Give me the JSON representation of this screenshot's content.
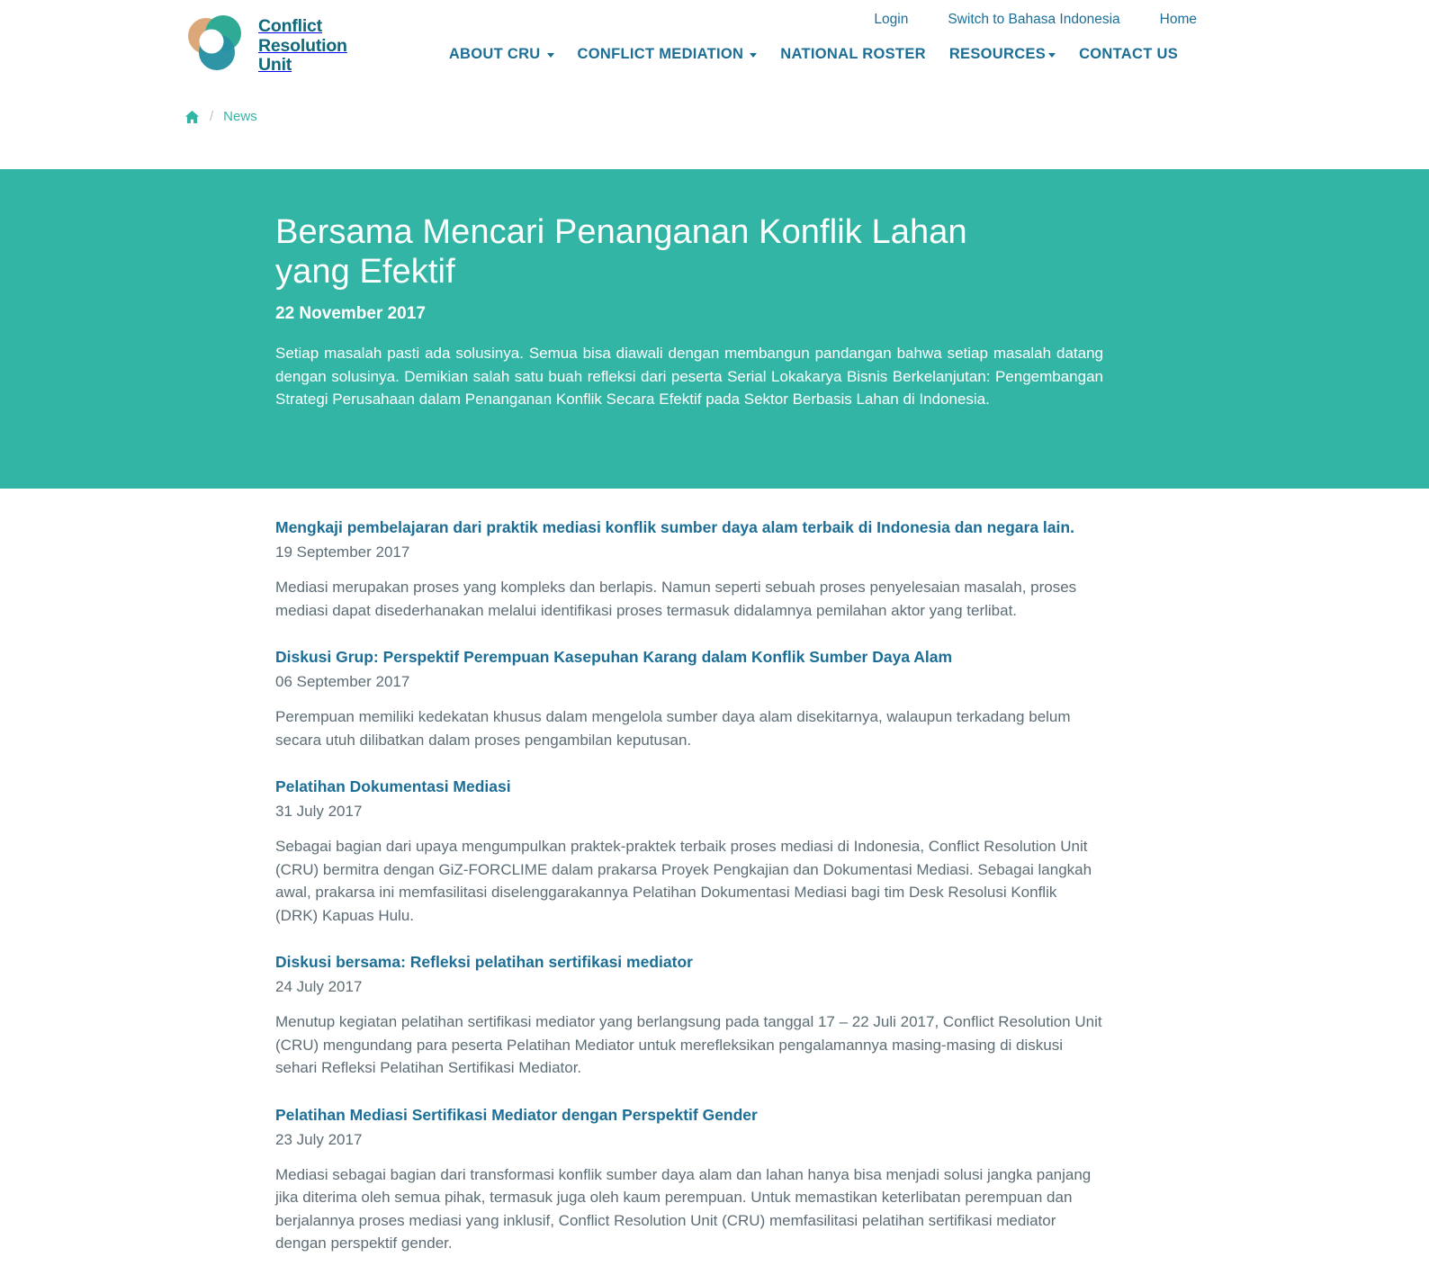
{
  "brand": {
    "logo_icon": "cru-circles-logo",
    "name": "Conflict\nResolution\nUnit"
  },
  "header": {
    "top_links": [
      {
        "label": "Login",
        "name": "login-link"
      },
      {
        "label": "Switch to Bahasa Indonesia",
        "name": "language-switch-link"
      },
      {
        "label": "Home",
        "name": "home-link"
      }
    ],
    "nav": [
      {
        "label": "ABOUT CRU",
        "has_caret": true
      },
      {
        "label": "CONFLICT MEDIATION",
        "has_caret": true
      },
      {
        "label": "NATIONAL ROSTER",
        "has_caret": false
      },
      {
        "label": "RESOURCES",
        "has_caret": true
      },
      {
        "label": "CONTACT US",
        "has_caret": false
      }
    ]
  },
  "breadcrumb": {
    "home_icon": "home-icon",
    "separator": "/",
    "current": "News"
  },
  "hero": {
    "title": "Bersama Mencari Penanganan Konflik Lahan yang Efektif",
    "date": "22 November 2017",
    "description": "Setiap masalah pasti ada solusinya. Semua bisa diawali dengan membangun pandangan bahwa setiap masalah datang dengan solusinya. Demikian salah satu buah refleksi dari peserta Serial Lokakarya Bisnis Berkelanjutan: Pengembangan Strategi Perusahaan dalam Penanganan Konflik Secara Efektif pada Sektor Berbasis Lahan di Indonesia."
  },
  "news": [
    {
      "title": "Mengkaji pembelajaran dari praktik mediasi konflik sumber daya alam terbaik di Indonesia dan negara lain.",
      "date": "19 September 2017",
      "excerpt": "Mediasi merupakan proses yang kompleks dan berlapis. Namun seperti sebuah proses penyelesaian masalah, proses mediasi dapat disederhanakan melalui identifikasi proses termasuk didalamnya pemilahan aktor yang terlibat."
    },
    {
      "title": "Diskusi Grup: Perspektif Perempuan Kasepuhan Karang dalam Konflik Sumber Daya Alam",
      "date": "06 September 2017",
      "excerpt": "Perempuan memiliki kedekatan khusus dalam mengelola sumber daya alam disekitarnya, walaupun terkadang belum secara utuh dilibatkan dalam proses pengambilan keputusan."
    },
    {
      "title": "Pelatihan Dokumentasi Mediasi",
      "date": "31 July 2017",
      "excerpt": "Sebagai bagian dari upaya mengumpulkan praktek-praktek terbaik proses mediasi di Indonesia, Conflict Resolution Unit (CRU) bermitra dengan GiZ-FORCLIME dalam prakarsa Proyek Pengkajian dan Dokumentasi Mediasi. Sebagai langkah awal, prakarsa ini memfasilitasi diselenggarakannya Pelatihan Dokumentasi Mediasi bagi tim Desk Resolusi Konflik (DRK) Kapuas Hulu."
    },
    {
      "title": "Diskusi bersama: Refleksi pelatihan sertifikasi mediator",
      "date": "24 July 2017",
      "excerpt": "Menutup kegiatan pelatihan sertifikasi mediator yang berlangsung pada tanggal 17 – 22 Juli 2017, Conflict Resolution Unit (CRU) mengundang para peserta Pelatihan Mediator untuk merefleksikan pengalamannya masing-masing di diskusi sehari Refleksi Pelatihan Sertifikasi Mediator."
    },
    {
      "title": "Pelatihan Mediasi Sertifikasi Mediator dengan Perspektif Gender",
      "date": "23 July 2017",
      "excerpt": "Mediasi sebagai bagian dari transformasi konflik sumber daya alam dan lahan hanya bisa menjadi solusi jangka panjang jika diterima oleh semua pihak, termasuk juga oleh kaum perempuan. Untuk memastikan keterlibatan perempuan dan berjalannya proses mediasi yang inklusif, Conflict Resolution Unit (CRU) memfasilitasi pelatihan sertifikasi mediator dengan perspektif gender."
    }
  ],
  "colors": {
    "hero_background": "#33b5a6",
    "link_blue": "#1c6e96",
    "body_text": "#5d6d75",
    "logo_teal": "#12687b",
    "logo_tan": "#dca87a",
    "logo_green": "#2faa94",
    "logo_dark_teal": "#1d7f8c"
  }
}
